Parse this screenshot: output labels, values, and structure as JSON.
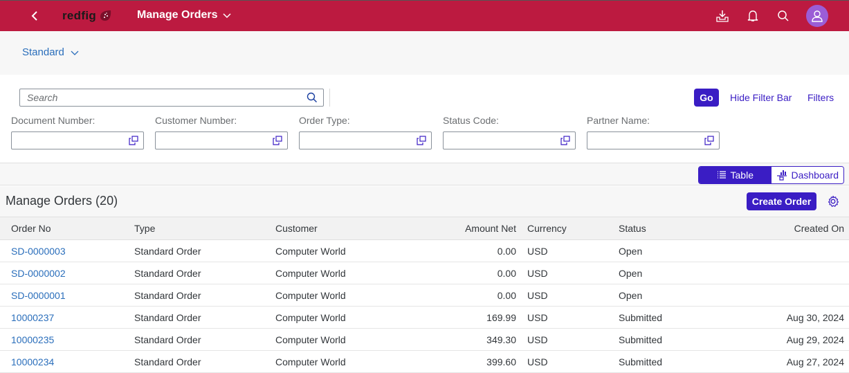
{
  "shell": {
    "brand": "redfig",
    "title": "Manage Orders",
    "icons": [
      "back-icon",
      "download-icon",
      "bell-icon",
      "search-icon",
      "user-icon"
    ],
    "colors": {
      "shell_bg": "#bc1a40",
      "avatar_bg": "#9b5dd6",
      "accent": "#3a1dc4",
      "link": "#2a6ebb"
    }
  },
  "variant": {
    "label": "Standard"
  },
  "filterbar": {
    "search_placeholder": "Search",
    "search_value": "",
    "go_label": "Go",
    "hide_label": "Hide Filter Bar",
    "filters_label": "Filters",
    "fields": [
      {
        "label": "Document Number:",
        "value": ""
      },
      {
        "label": "Customer Number:",
        "value": ""
      },
      {
        "label": "Order Type:",
        "value": ""
      },
      {
        "label": "Status Code:",
        "value": ""
      },
      {
        "label": "Partner Name:",
        "value": ""
      }
    ]
  },
  "view_switch": {
    "table_label": "Table",
    "dashboard_label": "Dashboard",
    "selected": "Table"
  },
  "table": {
    "title": "Manage Orders (20)",
    "create_label": "Create Order",
    "columns": [
      "Order No",
      "Type",
      "Customer",
      "Amount Net",
      "Currency",
      "Status",
      "Created On"
    ],
    "rows": [
      [
        "SD-0000003",
        "Standard Order",
        "Computer World",
        "0.00",
        "USD",
        "Open",
        ""
      ],
      [
        "SD-0000002",
        "Standard Order",
        "Computer World",
        "0.00",
        "USD",
        "Open",
        ""
      ],
      [
        "SD-0000001",
        "Standard Order",
        "Computer World",
        "0.00",
        "USD",
        "Open",
        ""
      ],
      [
        "10000237",
        "Standard Order",
        "Computer World",
        "169.99",
        "USD",
        "Submitted",
        "Aug 30, 2024"
      ],
      [
        "10000235",
        "Standard Order",
        "Computer World",
        "349.30",
        "USD",
        "Submitted",
        "Aug 29, 2024"
      ],
      [
        "10000234",
        "Standard Order",
        "Computer World",
        "399.60",
        "USD",
        "Submitted",
        "Aug 27, 2024"
      ]
    ]
  }
}
